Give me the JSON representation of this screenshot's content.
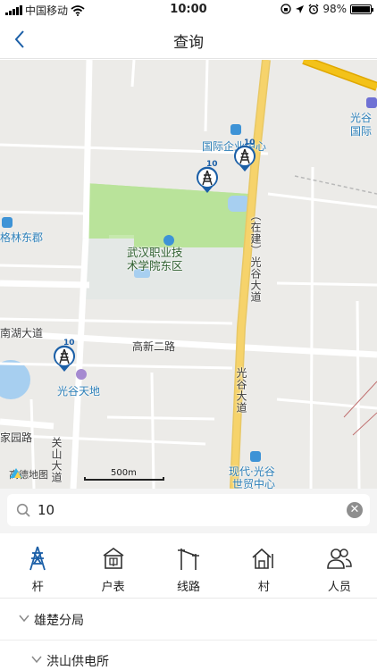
{
  "status_bar": {
    "carrier": "中国移动",
    "time": "10:00",
    "battery": "98%",
    "battery_level": 0.98
  },
  "nav": {
    "title": "查询"
  },
  "map": {
    "labels": {
      "guanggu_top_right": "光谷",
      "guoji_right": "国际",
      "intl_center": "国际企业中心",
      "gelin": "格林东郡",
      "campus_line1": "武汉职业技",
      "campus_line2": "术学院东区",
      "hehu": "南湖大道",
      "gaoxin": "高新二路",
      "guanggu_tiandi": "光谷天地",
      "jiayuan": "家园路",
      "guanshan": "关山大道",
      "guanggu_dadao_north": "（在建）光谷大道",
      "guanggu_dadao_south": "光谷大道",
      "xiandai_line1": "现代·光谷",
      "xiandai_line2": "世贸中心"
    },
    "markers": [
      {
        "count": "10",
        "icon": "tower-icon"
      },
      {
        "count": "10",
        "icon": "tower-icon"
      },
      {
        "count": "10",
        "icon": "tower-icon"
      }
    ],
    "logo_text": "高德地图",
    "scale_text": "500m"
  },
  "search": {
    "value": "10",
    "clear_symbol": "✕"
  },
  "tabs": [
    {
      "label": "杆",
      "icon": "tower-icon",
      "active": true
    },
    {
      "label": "户表",
      "icon": "meter-icon",
      "active": false
    },
    {
      "label": "线路",
      "icon": "power-line-icon",
      "active": false
    },
    {
      "label": "村",
      "icon": "village-icon",
      "active": false
    },
    {
      "label": "人员",
      "icon": "people-icon",
      "active": false
    }
  ],
  "tree": [
    {
      "label": "雄楚分局",
      "level": 0
    },
    {
      "label": "洪山供电所",
      "level": 1
    }
  ],
  "colors": {
    "accent": "#1b5fa7",
    "campus_green": "#b9e39a",
    "road_yellow": "#f6d36b",
    "map_bg": "#ecebe8"
  }
}
